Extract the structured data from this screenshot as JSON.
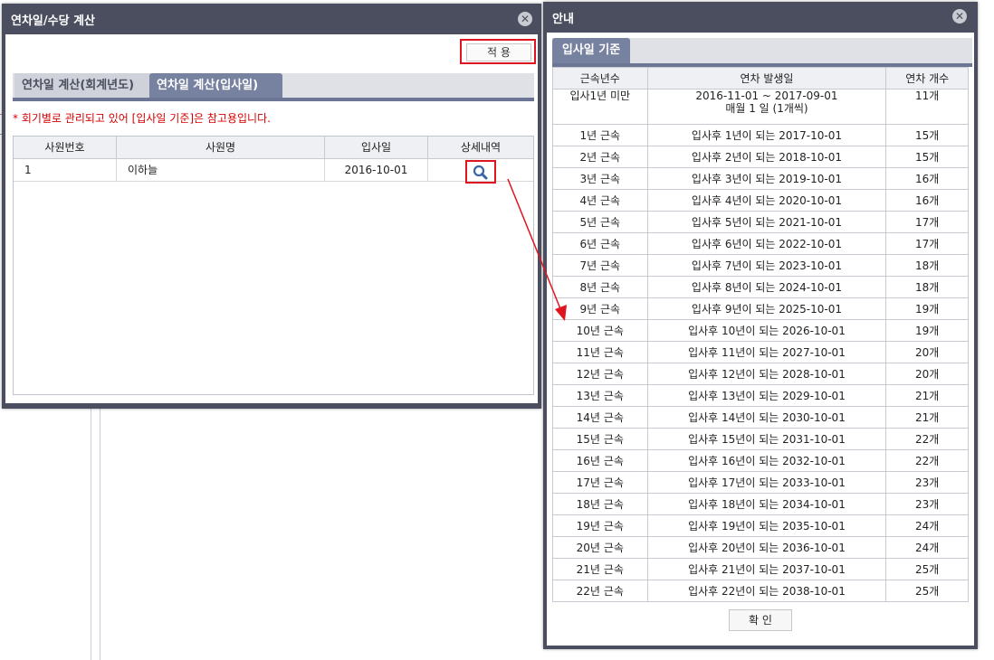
{
  "left_window": {
    "title": "연차일/수당 계산",
    "apply_label": "적 용",
    "tabs": [
      "연차일 계산(회계년도)",
      "연차일 계산(입사일)"
    ],
    "notice": "* 회기별로 관리되고 있어 [입사일 기준]은 참고용입니다.",
    "columns": [
      "사원번호",
      "사원명",
      "입사일",
      "상세내역"
    ],
    "rows": [
      {
        "emp_no": "1",
        "name": "이하늘",
        "hire_date": "2016-10-01"
      }
    ]
  },
  "right_window": {
    "title": "안내",
    "tab": "입사일 기준",
    "columns": [
      "근속년수",
      "연차 발생일",
      "연차 개수"
    ],
    "rows": [
      {
        "years": "입사1년 미만",
        "date": "2016-11-01 ~ 2017-09-01",
        "date2": "매월 1 일 (1개씩)",
        "count": "11개"
      },
      {
        "years": "1년 근속",
        "date": "입사후 1년이 되는 2017-10-01",
        "count": "15개"
      },
      {
        "years": "2년 근속",
        "date": "입사후 2년이 되는 2018-10-01",
        "count": "15개"
      },
      {
        "years": "3년 근속",
        "date": "입사후 3년이 되는 2019-10-01",
        "count": "16개"
      },
      {
        "years": "4년 근속",
        "date": "입사후 4년이 되는 2020-10-01",
        "count": "16개"
      },
      {
        "years": "5년 근속",
        "date": "입사후 5년이 되는 2021-10-01",
        "count": "17개"
      },
      {
        "years": "6년 근속",
        "date": "입사후 6년이 되는 2022-10-01",
        "count": "17개"
      },
      {
        "years": "7년 근속",
        "date": "입사후 7년이 되는 2023-10-01",
        "count": "18개"
      },
      {
        "years": "8년 근속",
        "date": "입사후 8년이 되는 2024-10-01",
        "count": "18개"
      },
      {
        "years": "9년 근속",
        "date": "입사후 9년이 되는 2025-10-01",
        "count": "19개"
      },
      {
        "years": "10년 근속",
        "date": "입사후 10년이 되는 2026-10-01",
        "count": "19개"
      },
      {
        "years": "11년 근속",
        "date": "입사후 11년이 되는 2027-10-01",
        "count": "20개"
      },
      {
        "years": "12년 근속",
        "date": "입사후 12년이 되는 2028-10-01",
        "count": "20개"
      },
      {
        "years": "13년 근속",
        "date": "입사후 13년이 되는 2029-10-01",
        "count": "21개"
      },
      {
        "years": "14년 근속",
        "date": "입사후 14년이 되는 2030-10-01",
        "count": "21개"
      },
      {
        "years": "15년 근속",
        "date": "입사후 15년이 되는 2031-10-01",
        "count": "22개"
      },
      {
        "years": "16년 근속",
        "date": "입사후 16년이 되는 2032-10-01",
        "count": "22개"
      },
      {
        "years": "17년 근속",
        "date": "입사후 17년이 되는 2033-10-01",
        "count": "23개"
      },
      {
        "years": "18년 근속",
        "date": "입사후 18년이 되는 2034-10-01",
        "count": "23개"
      },
      {
        "years": "19년 근속",
        "date": "입사후 19년이 되는 2035-10-01",
        "count": "24개"
      },
      {
        "years": "20년 근속",
        "date": "입사후 20년이 되는 2036-10-01",
        "count": "24개"
      },
      {
        "years": "21년 근속",
        "date": "입사후 21년이 되는 2037-10-01",
        "count": "25개"
      },
      {
        "years": "22년 근속",
        "date": "입사후 22년이 되는 2038-10-01",
        "count": "25개"
      }
    ],
    "confirm_label": "확 인"
  },
  "colors": {
    "window_frame": "#4a4e5e",
    "tab_active": "#7781a0",
    "highlight_red": "#e0141e",
    "notice_red": "#d60000"
  },
  "icons": {
    "close": "close-icon",
    "search": "search-icon"
  }
}
